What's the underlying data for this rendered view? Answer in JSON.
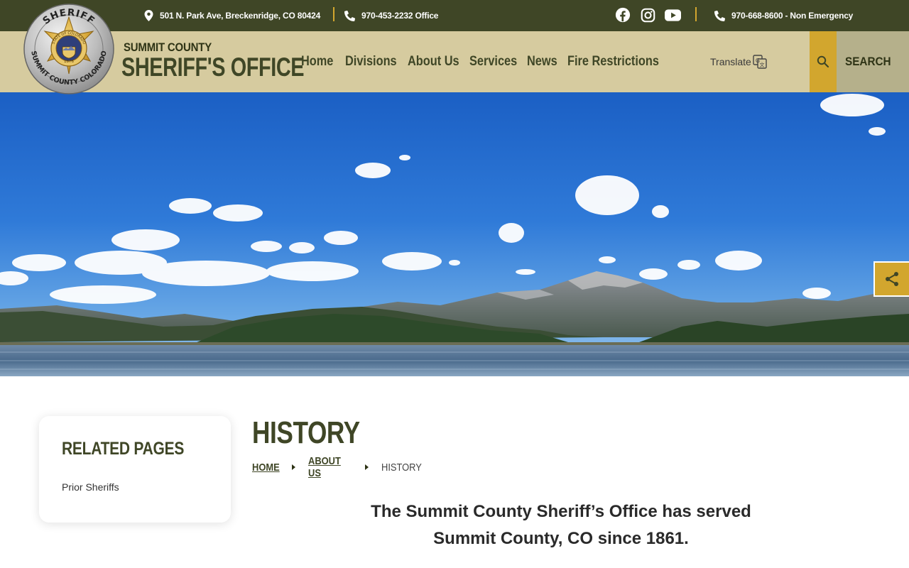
{
  "topbar": {
    "address": "501 N. Park Ave, Breckenridge, CO 80424",
    "office_phone": "970-453-2232 Office",
    "non_emergency": "970-668-8600 - Non Emergency",
    "social": [
      "facebook-icon",
      "instagram-icon",
      "youtube-icon"
    ]
  },
  "logo": {
    "top_text": "SHERIFF",
    "bottom_text": "SUMMIT COUNTY COLORADO",
    "seal_text": "STATE OF COLORADO",
    "year": "1876"
  },
  "header": {
    "site_sub": "SUMMIT COUNTY",
    "site_name": "SHERIFF'S OFFICE",
    "nav": [
      "Home",
      "Divisions",
      "About Us",
      "Services",
      "News",
      "Fire Restrictions"
    ],
    "translate": "Translate",
    "search": "SEARCH"
  },
  "sidebar": {
    "title": "RELATED PAGES",
    "links": [
      "Prior Sheriffs"
    ]
  },
  "main": {
    "title": "HISTORY",
    "breadcrumb": [
      "HOME",
      "ABOUT US",
      "HISTORY"
    ],
    "intro": "The Summit County Sheriff’s Office has served Summit County, CO since 1861."
  },
  "colors": {
    "brand_dark": "#3f4626",
    "tan": "#d6cb9f",
    "gold": "#d2a62e"
  }
}
